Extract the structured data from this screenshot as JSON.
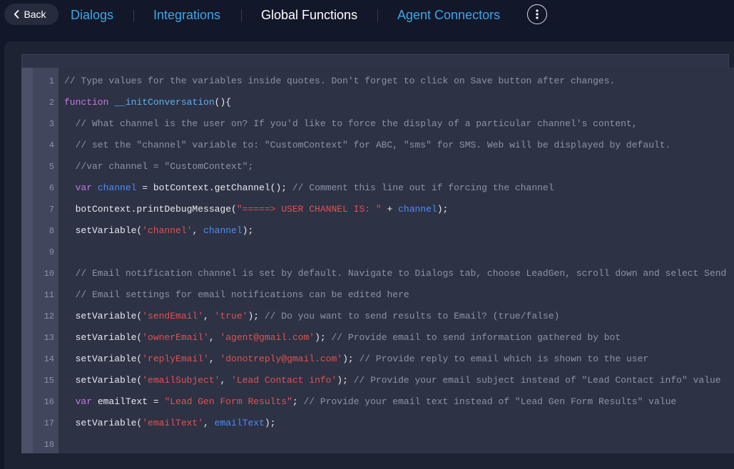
{
  "nav": {
    "back_label": "Back",
    "tabs": [
      {
        "label": "Dialogs",
        "active": false
      },
      {
        "label": "Integrations",
        "active": false
      },
      {
        "label": "Global Functions",
        "active": true
      },
      {
        "label": "Agent Connectors",
        "active": false
      }
    ],
    "more_icon": "vertical-dots-icon"
  },
  "colors": {
    "tab_link": "#3ea6e6",
    "tab_active": "#ffffff",
    "comment": "#8d93a8",
    "keyword": "#c678dd",
    "function_name": "#61aeee",
    "variable": "#4c8df6",
    "string": "#e0524f"
  },
  "editor": {
    "lines": [
      {
        "n": "1",
        "tokens": [
          {
            "c": "c",
            "t": "// Type values for the variables inside quotes. Don't forget to click on Save button after changes."
          }
        ]
      },
      {
        "n": "2",
        "tokens": [
          {
            "c": "k",
            "t": "function"
          },
          {
            "c": "t",
            "t": " "
          },
          {
            "c": "f",
            "t": "__initConversation"
          },
          {
            "c": "t",
            "t": "(){"
          }
        ]
      },
      {
        "n": "3",
        "tokens": [
          {
            "c": "c",
            "t": "  // What channel is the user on? If you'd like to force the display of a particular channel's content,"
          }
        ]
      },
      {
        "n": "4",
        "tokens": [
          {
            "c": "c",
            "t": "  // set the \"channel\" variable to: \"CustomContext\" for ABC, \"sms\" for SMS. Web will be displayed by default."
          }
        ]
      },
      {
        "n": "5",
        "tokens": [
          {
            "c": "c",
            "t": "  //var channel = \"CustomContext\";"
          }
        ]
      },
      {
        "n": "6",
        "tokens": [
          {
            "c": "t",
            "t": "  "
          },
          {
            "c": "k",
            "t": "var"
          },
          {
            "c": "t",
            "t": " "
          },
          {
            "c": "v",
            "t": "channel"
          },
          {
            "c": "t",
            "t": " = botContext.getChannel(); "
          },
          {
            "c": "c",
            "t": "// Comment this line out if forcing the channel"
          }
        ]
      },
      {
        "n": "7",
        "tokens": [
          {
            "c": "t",
            "t": "  botContext.printDebugMessage("
          },
          {
            "c": "s",
            "t": "\"=====> USER CHANNEL IS: \""
          },
          {
            "c": "t",
            "t": " + "
          },
          {
            "c": "v",
            "t": "channel"
          },
          {
            "c": "t",
            "t": ");"
          }
        ]
      },
      {
        "n": "8",
        "tokens": [
          {
            "c": "t",
            "t": "  setVariable("
          },
          {
            "c": "s",
            "t": "'channel'"
          },
          {
            "c": "t",
            "t": ", "
          },
          {
            "c": "v",
            "t": "channel"
          },
          {
            "c": "t",
            "t": ");"
          }
        ]
      },
      {
        "n": "9",
        "tokens": []
      },
      {
        "n": "10",
        "tokens": [
          {
            "c": "c",
            "t": "  // Email notification channel is set by default. Navigate to Dialogs tab, choose LeadGen, scroll down and select Send"
          }
        ]
      },
      {
        "n": "11",
        "tokens": [
          {
            "c": "c",
            "t": "  // Email settings for email notifications can be edited here"
          }
        ]
      },
      {
        "n": "12",
        "tokens": [
          {
            "c": "t",
            "t": "  setVariable("
          },
          {
            "c": "s",
            "t": "'sendEmail'"
          },
          {
            "c": "t",
            "t": ", "
          },
          {
            "c": "s",
            "t": "'true'"
          },
          {
            "c": "t",
            "t": "); "
          },
          {
            "c": "c",
            "t": "// Do you want to send results to Email? (true/false)"
          }
        ]
      },
      {
        "n": "13",
        "tokens": [
          {
            "c": "t",
            "t": "  setVariable("
          },
          {
            "c": "s",
            "t": "'ownerEmail'"
          },
          {
            "c": "t",
            "t": ", "
          },
          {
            "c": "s",
            "t": "'agent@gmail.com'"
          },
          {
            "c": "t",
            "t": "); "
          },
          {
            "c": "c",
            "t": "// Provide email to send information gathered by bot"
          }
        ]
      },
      {
        "n": "14",
        "tokens": [
          {
            "c": "t",
            "t": "  setVariable("
          },
          {
            "c": "s",
            "t": "'replyEmail'"
          },
          {
            "c": "t",
            "t": ", "
          },
          {
            "c": "s",
            "t": "'donotreply@gmail.com'"
          },
          {
            "c": "t",
            "t": "); "
          },
          {
            "c": "c",
            "t": "// Provide reply to email which is shown to the user"
          }
        ]
      },
      {
        "n": "15",
        "tokens": [
          {
            "c": "t",
            "t": "  setVariable("
          },
          {
            "c": "s",
            "t": "'emailSubject'"
          },
          {
            "c": "t",
            "t": ", "
          },
          {
            "c": "s",
            "t": "'Lead Contact info'"
          },
          {
            "c": "t",
            "t": "); "
          },
          {
            "c": "c",
            "t": "// Provide your email subject instead of \"Lead Contact info\" value"
          }
        ]
      },
      {
        "n": "16",
        "tokens": [
          {
            "c": "t",
            "t": "  "
          },
          {
            "c": "k",
            "t": "var"
          },
          {
            "c": "t",
            "t": " emailText = "
          },
          {
            "c": "s",
            "t": "\"Lead Gen Form Results\""
          },
          {
            "c": "t",
            "t": "; "
          },
          {
            "c": "c",
            "t": "// Provide your email text instead of \"Lead Gen Form Results\" value"
          }
        ]
      },
      {
        "n": "17",
        "tokens": [
          {
            "c": "t",
            "t": "  setVariable("
          },
          {
            "c": "s",
            "t": "'emailText'"
          },
          {
            "c": "t",
            "t": ", "
          },
          {
            "c": "v",
            "t": "emailText"
          },
          {
            "c": "t",
            "t": ");"
          }
        ]
      },
      {
        "n": "18",
        "tokens": []
      }
    ]
  }
}
